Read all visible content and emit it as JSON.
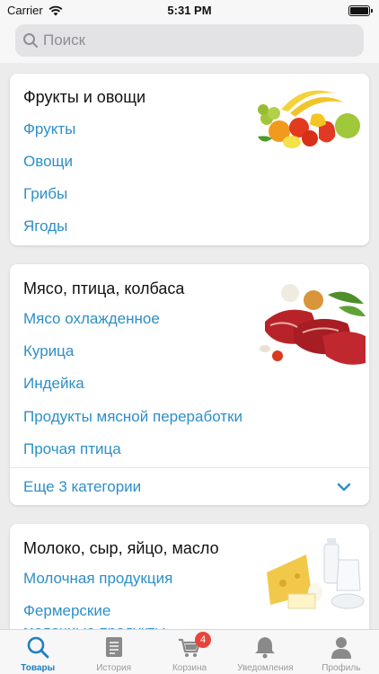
{
  "status_bar": {
    "carrier": "Carrier",
    "time": "5:31 PM"
  },
  "search": {
    "placeholder": "Поиск"
  },
  "sections": [
    {
      "title": "Фрукты и овощи",
      "image_icon": "fruits-vegetables-image",
      "categories": [
        "Фрукты",
        "Овощи",
        "Грибы",
        "Ягоды"
      ]
    },
    {
      "title": "Мясо, птица, колбаса",
      "image_icon": "meat-image",
      "categories": [
        "Мясо охлажденное",
        "Курица",
        "Индейка",
        "Продукты мясной переработки",
        "Прочая птица"
      ],
      "more_label": "Еще 3 категории"
    },
    {
      "title": "Молоко, сыр, яйцо, масло",
      "image_icon": "dairy-image",
      "categories": [
        "Молочная продукция",
        "Фермерские",
        "молочные продукты"
      ]
    }
  ],
  "tab_bar": {
    "tabs": [
      {
        "label": "Товары",
        "icon": "search-icon",
        "active": true
      },
      {
        "label": "История",
        "icon": "document-icon"
      },
      {
        "label": "Корзина",
        "icon": "cart-icon",
        "badge": "4"
      },
      {
        "label": "Уведомления",
        "icon": "bell-icon"
      },
      {
        "label": "Профиль",
        "icon": "person-icon"
      }
    ]
  },
  "colors": {
    "accent": "#2d8fc8",
    "active_tab": "#1f7fc0",
    "badge": "#e8453c",
    "background": "#ececec"
  }
}
